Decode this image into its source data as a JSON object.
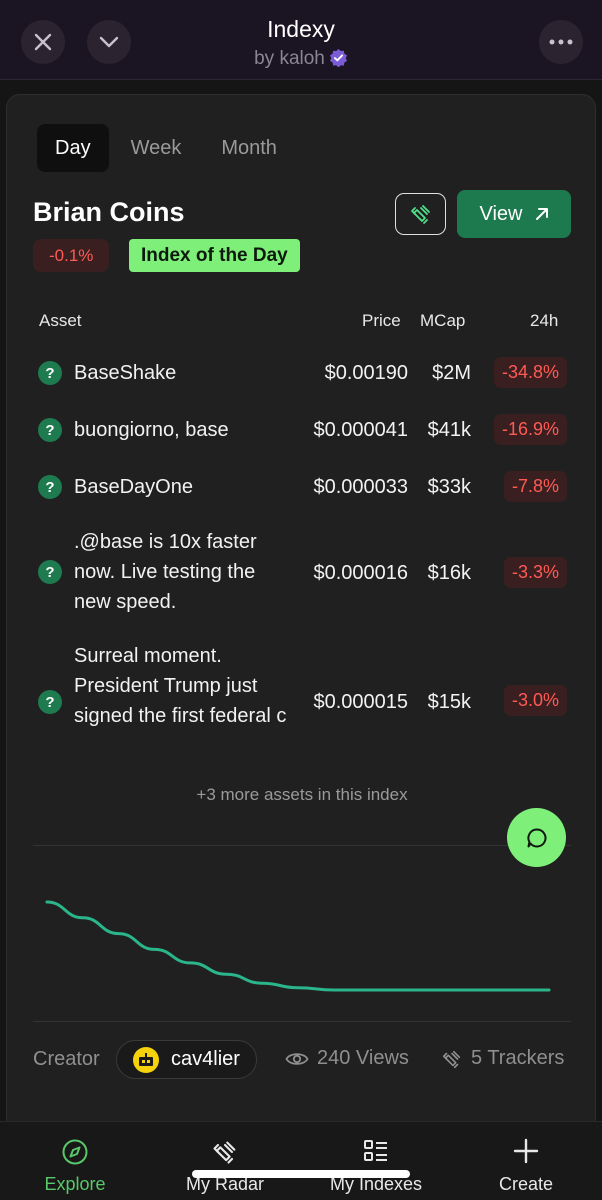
{
  "header": {
    "title": "Indexy",
    "subtitle": "by kaloh"
  },
  "tabs": [
    {
      "label": "Day",
      "active": true
    },
    {
      "label": "Week",
      "active": false
    },
    {
      "label": "Month",
      "active": false
    }
  ],
  "index": {
    "name": "Brian Coins",
    "change": "-0.1%",
    "badge": "Index of the Day",
    "view_label": "View"
  },
  "table": {
    "headers": {
      "asset": "Asset",
      "price": "Price",
      "mcap": "MCap",
      "change": "24h"
    },
    "rows": [
      {
        "name": "BaseShake",
        "price": "$0.00190",
        "mcap": "$2M",
        "change": "-34.8%"
      },
      {
        "name": "buongiorno, base",
        "price": "$0.000041",
        "mcap": "$41k",
        "change": "-16.9%"
      },
      {
        "name": "BaseDayOne",
        "price": "$0.000033",
        "mcap": "$33k",
        "change": "-7.8%"
      },
      {
        "name": ".@base is 10x faster now. Live testing the new speed.",
        "price": "$0.000016",
        "mcap": "$16k",
        "change": "-3.3%"
      },
      {
        "name": "Surreal moment. President Trump just signed the first federal c",
        "price": "$0.000015",
        "mcap": "$15k",
        "change": "-3.0%"
      }
    ],
    "more_text": "+3 more assets in this index"
  },
  "chart_data": {
    "type": "line",
    "series": [
      {
        "values": [
          100,
          93,
          86,
          79,
          73,
          68,
          64,
          62,
          61,
          61,
          61,
          61,
          61,
          61,
          61
        ]
      }
    ],
    "color": "#2bb58a"
  },
  "footer": {
    "creator_label": "Creator",
    "creator_name": "cav4lier",
    "views": "240 Views",
    "trackers": "5 Trackers"
  },
  "nav": [
    {
      "label": "Explore",
      "icon": "compass-icon",
      "active": true
    },
    {
      "label": "My Radar",
      "icon": "satellite-icon",
      "active": false
    },
    {
      "label": "My Indexes",
      "icon": "list-icon",
      "active": false
    },
    {
      "label": "Create",
      "icon": "plus-icon",
      "active": false
    }
  ],
  "colors": {
    "accent_green": "#7ef07a",
    "button_green": "#1d7a4e",
    "negative_red": "#ff5a55"
  }
}
